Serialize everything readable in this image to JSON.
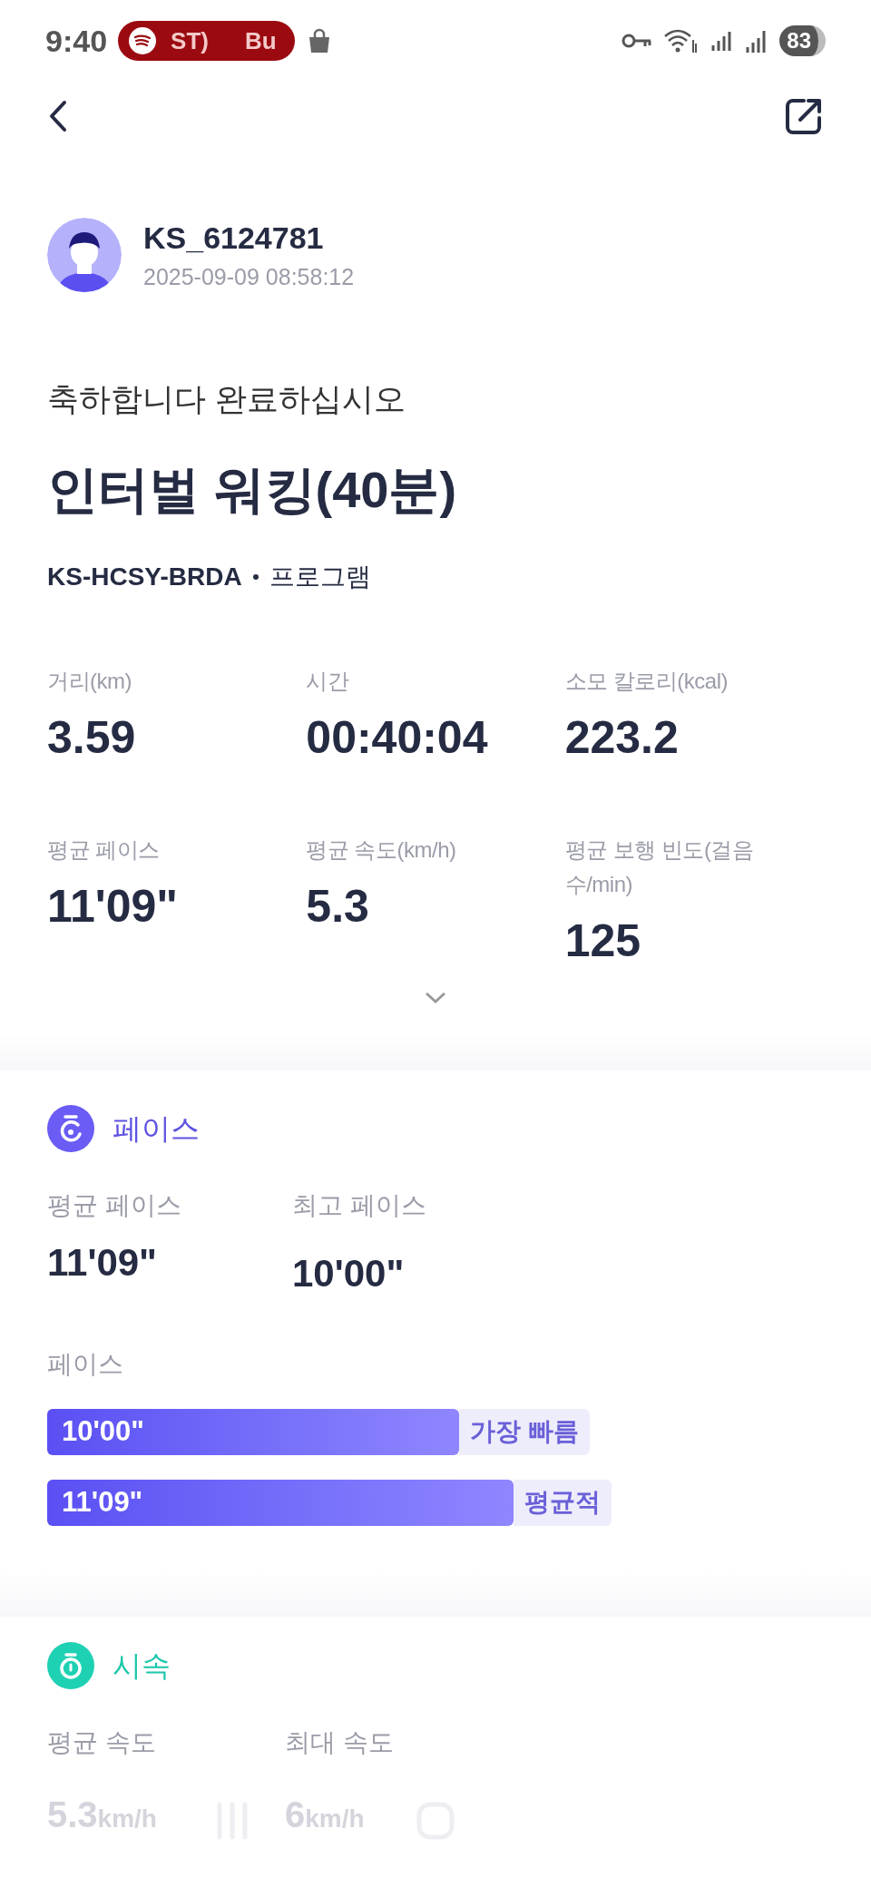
{
  "status_bar": {
    "time": "9:40",
    "media_pill": [
      "ST)",
      "Bu"
    ],
    "battery": "83"
  },
  "user": {
    "name": "KS_6124781",
    "datetime": "2025-09-09 08:58:12"
  },
  "congrats": "축하합니다 완료하십시오",
  "workout_title": "인터벌 워킹(40분)",
  "program_code": "KS-HCSY-BRDA",
  "program_label": "프로그램",
  "stats": [
    {
      "label": "거리(km)",
      "value": "3.59"
    },
    {
      "label": "시간",
      "value": "00:40:04"
    },
    {
      "label": "소모 칼로리(kcal)",
      "value": "223.2"
    },
    {
      "label": "평균 페이스",
      "value": "11'09\""
    },
    {
      "label": "평균 속도(km/h)",
      "value": "5.3"
    },
    {
      "label": "평균 보행 빈도(걸음 수/min)",
      "value": "125"
    }
  ],
  "pace_section": {
    "title": "페이스",
    "metrics": [
      {
        "label": "평균 페이스",
        "value": "11'09\""
      },
      {
        "label": "최고 페이스",
        "value": "10'00\""
      }
    ],
    "chart_label": "페이스",
    "bars": [
      {
        "value": "10'00\"",
        "tag": "가장 빠름"
      },
      {
        "value": "11'09\"",
        "tag": "평균적"
      }
    ]
  },
  "speed_section": {
    "title": "시속",
    "metrics": [
      {
        "label": "평균 속도",
        "value": "5.3",
        "unit": "km/h"
      },
      {
        "label": "최대 속도",
        "value": "6",
        "unit": "km/h"
      }
    ]
  }
}
